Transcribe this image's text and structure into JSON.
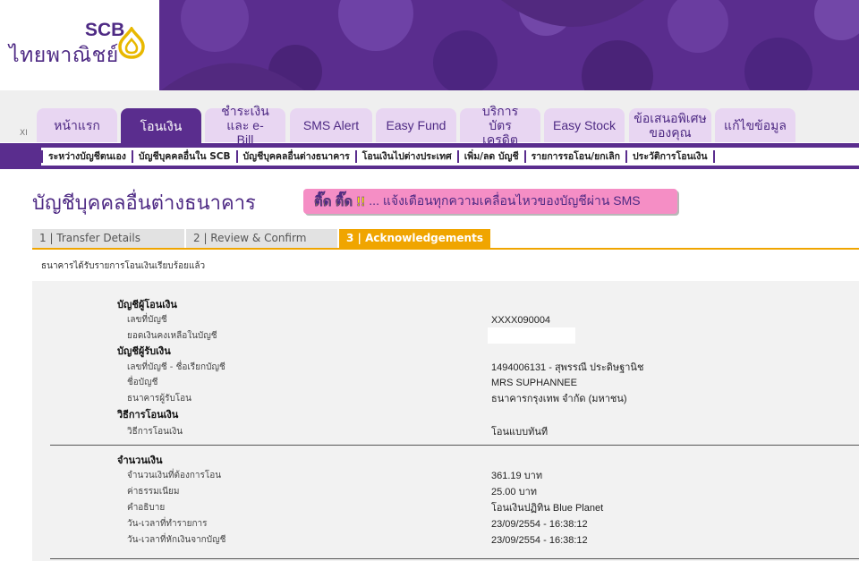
{
  "brand": {
    "name": "SCB",
    "thai_name": "ไทยพาณิชย์"
  },
  "tabs": [
    {
      "label": "หน้าแรก"
    },
    {
      "label": "โอนเงิน"
    },
    {
      "label": "ชำระเงิน และ e-Bill"
    },
    {
      "label": "SMS Alert"
    },
    {
      "label": "Easy Fund"
    },
    {
      "label": "บริการ บัตรเครดิต"
    },
    {
      "label": "Easy Stock"
    },
    {
      "label": "ข้อเสนอพิเศษ ของคุณ"
    },
    {
      "label": "แก้ไขข้อมูล"
    }
  ],
  "tab_marker": "XI",
  "subnav": [
    "ระหว่างบัญชีตนเอง",
    "บัญชีบุคคลอื่นใน SCB",
    "บัญชีบุคคลอื่นต่างธนาคาร",
    "โอนเงินไปต่างประเทศ",
    "เพิ่ม/ลด บัญชี",
    "รายการรอโอน/ยกเลิก",
    "ประวัติการโอนเงิน"
  ],
  "page_title": "บัญชีบุคคลอื่นต่างธนาคาร",
  "promo": {
    "highlight": "ติ๊ด ติ๊ด !!",
    "text": "... แจ้งเตือนทุกความเคลื่อนไหวของบัญชีผ่าน SMS"
  },
  "steps": [
    "1 | Transfer Details",
    "2 | Review & Confirm",
    "3 | Acknowledgements"
  ],
  "notice": "ธนาคารได้รับรายการโอนเงินเรียบร้อยแล้ว",
  "details": {
    "from_heading": "บัญชีผู้โอนเงิน",
    "from_account_label": "เลขที่บัญชี",
    "from_account_value": "XXXX090004",
    "balance_label": "ยอดเงินคงเหลือในบัญชี",
    "to_heading": "บัญชีผู้รับเงิน",
    "to_account_label": "เลขที่บัญชี - ชื่อเรียกบัญชี",
    "to_account_value": "1494006131 - สุพรรณี ประดิษฐานิช",
    "account_name_label": "ชื่อบัญชี",
    "account_name_value": "MRS SUPHANNEE",
    "bank_label": "ธนาคารผู้รับโอน",
    "bank_value": "ธนาคารกรุงเทพ จำกัด (มหาชน)",
    "method_heading": "วิธีการโอนเงิน",
    "method_label": "วิธีการโอนเงิน",
    "method_value": "โอนแบบทันที",
    "amount_heading": "จำนวนเงิน",
    "amount_label": "จำนวนเงินที่ต้องการโอน",
    "amount_value": "361.19 บาท",
    "fee_label": "ค่าธรรมเนียม",
    "fee_value": "25.00 บาท",
    "desc_label": "คำอธิบาย",
    "desc_value": "โอนเงินปฏิทิน Blue Planet",
    "txn_date_label": "วัน-เวลาที่ทำรายการ",
    "txn_date_value": "23/09/2554 - 16:38:12",
    "debit_date_label": "วัน-เวลาที่หักเงินจากบัญชี",
    "debit_date_value": "23/09/2554 - 16:38:12"
  }
}
